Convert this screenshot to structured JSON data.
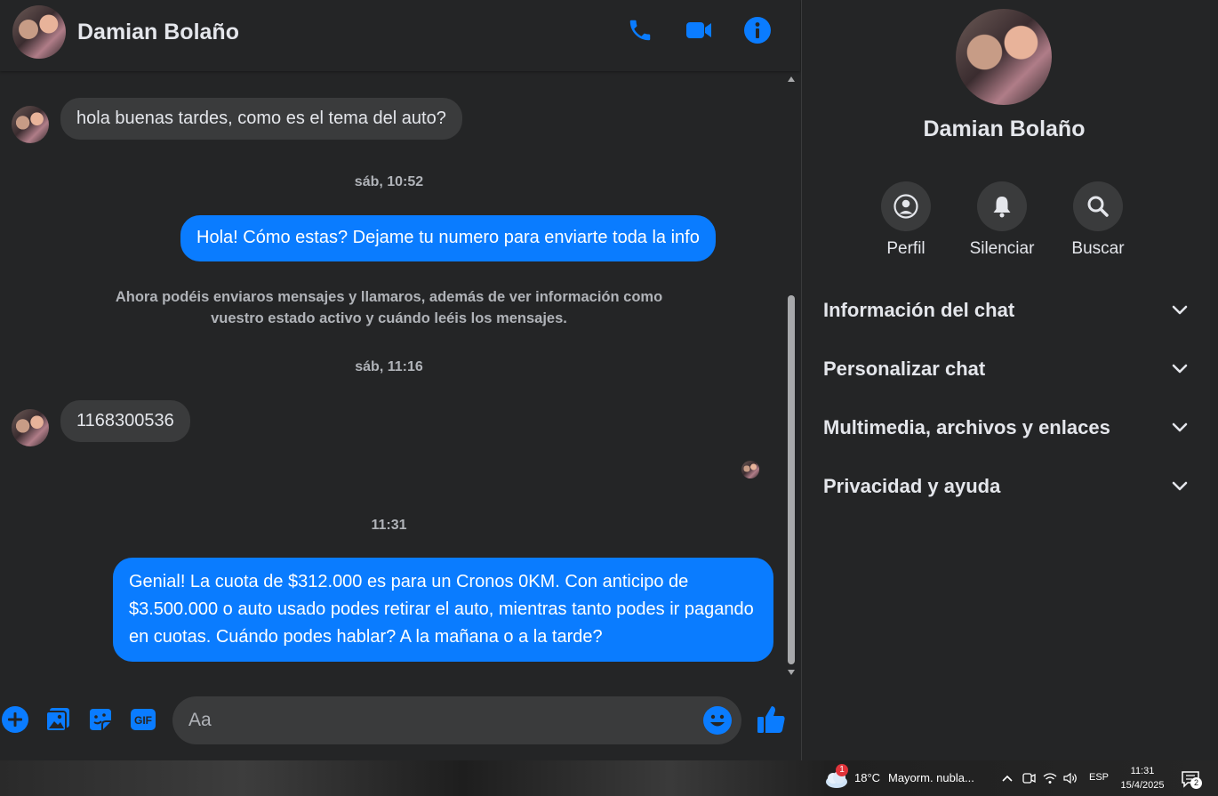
{
  "header": {
    "contact_name": "Damian Bolaño",
    "icons": [
      "phone-icon",
      "video-camera-icon",
      "info-icon"
    ]
  },
  "messages": [
    {
      "type": "incoming",
      "text": "hola buenas tardes, como es el tema del auto?"
    },
    {
      "type": "timestamp",
      "text": "sáb, 10:52"
    },
    {
      "type": "outgoing",
      "text": "Hola! Cómo estas? Dejame tu numero para enviarte toda la info"
    },
    {
      "type": "system",
      "text": "Ahora podéis enviaros mensajes y llamaros, además de ver información como vuestro estado activo y cuándo leéis los mensajes."
    },
    {
      "type": "timestamp",
      "text": "sáb, 11:16"
    },
    {
      "type": "incoming",
      "text": "1168300536"
    },
    {
      "type": "timestamp",
      "text": "11:31"
    },
    {
      "type": "outgoing",
      "text": "Genial! La cuota de $312.000 es para un Cronos 0KM. Con anticipo de $3.500.000 o auto usado podes retirar el auto, mientras tanto podes ir pagando en cuotas. Cuándo podes hablar? A la mañana o a la tarde?"
    }
  ],
  "composer": {
    "placeholder": "Aa",
    "icons": [
      "plus-icon",
      "image-icon",
      "sticker-icon",
      "gif-icon",
      "emoji-icon",
      "thumbs-up-icon"
    ]
  },
  "panel": {
    "contact_name": "Damian Bolaño",
    "actions": [
      {
        "label": "Perfil",
        "icon": "profile-icon"
      },
      {
        "label": "Silenciar",
        "icon": "bell-icon"
      },
      {
        "label": "Buscar",
        "icon": "search-icon"
      }
    ],
    "sections": [
      {
        "label": "Información del chat"
      },
      {
        "label": "Personalizar chat"
      },
      {
        "label": "Multimedia, archivos y enlaces"
      },
      {
        "label": "Privacidad y ayuda"
      }
    ]
  },
  "taskbar": {
    "weather_badge": "1",
    "temperature": "18°C",
    "weather_text": "Mayorm. nubla...",
    "language": "ESP",
    "time": "11:31",
    "date": "15/4/2025",
    "notification_count": "2"
  },
  "colors": {
    "accent": "#0a7cff",
    "background": "#242526",
    "bubble_incoming": "#3a3b3c"
  }
}
